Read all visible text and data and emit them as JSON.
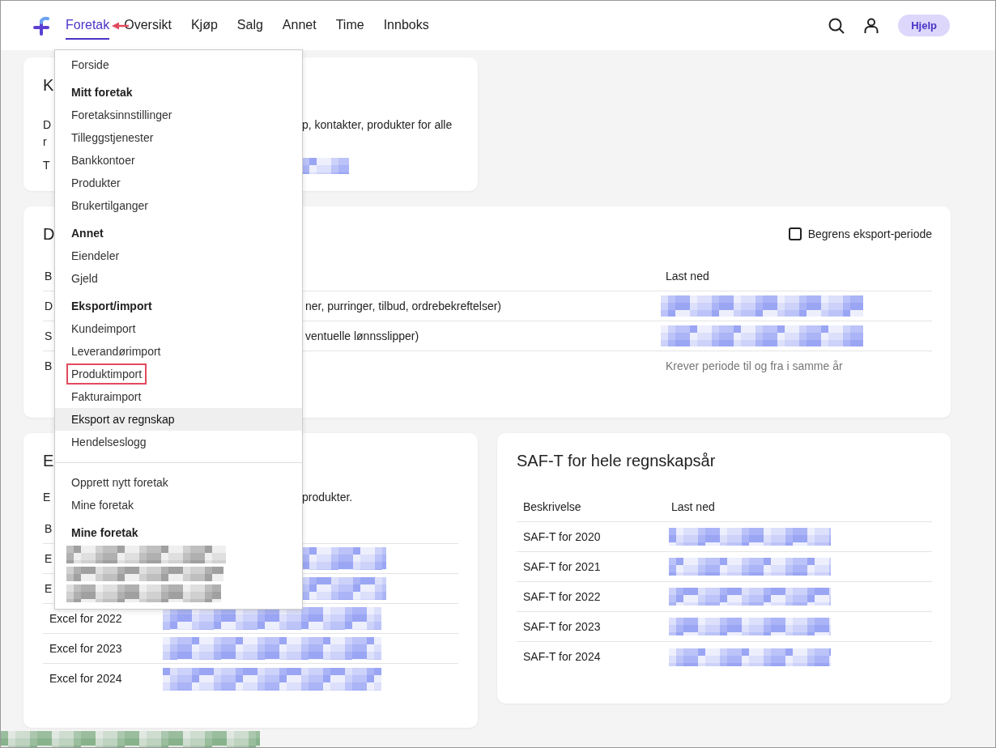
{
  "nav": {
    "items": [
      {
        "label": "Foretak",
        "selected": true,
        "pointed_at": true
      },
      {
        "label": "Oversikt",
        "selected": false,
        "pointed_at": false
      },
      {
        "label": "Kjøp",
        "selected": false,
        "pointed_at": false
      },
      {
        "label": "Salg",
        "selected": false,
        "pointed_at": false
      },
      {
        "label": "Annet",
        "selected": false,
        "pointed_at": false
      },
      {
        "label": "Time",
        "selected": false,
        "pointed_at": false
      },
      {
        "label": "Innboks",
        "selected": false,
        "pointed_at": false
      }
    ],
    "help_button": "Hjelp"
  },
  "dropdown": [
    {
      "kind": "link",
      "label": "Forside",
      "hovered": false,
      "highlighted": false
    },
    {
      "kind": "header",
      "label": "Mitt foretak"
    },
    {
      "kind": "link",
      "label": "Foretaksinnstillinger",
      "hovered": false,
      "highlighted": false
    },
    {
      "kind": "link",
      "label": "Tilleggstjenester",
      "hovered": false,
      "highlighted": false
    },
    {
      "kind": "link",
      "label": "Bankkontoer",
      "hovered": false,
      "highlighted": false
    },
    {
      "kind": "link",
      "label": "Produkter",
      "hovered": false,
      "highlighted": false
    },
    {
      "kind": "link",
      "label": "Brukertilganger",
      "hovered": false,
      "highlighted": false
    },
    {
      "kind": "header",
      "label": "Annet"
    },
    {
      "kind": "link",
      "label": "Eiendeler",
      "hovered": false,
      "highlighted": false
    },
    {
      "kind": "link",
      "label": "Gjeld",
      "hovered": false,
      "highlighted": false
    },
    {
      "kind": "header",
      "label": "Eksport/import"
    },
    {
      "kind": "link",
      "label": "Kundeimport",
      "hovered": false,
      "highlighted": false
    },
    {
      "kind": "link",
      "label": "Leverandørimport",
      "hovered": false,
      "highlighted": false
    },
    {
      "kind": "link",
      "label": "Produktimport",
      "hovered": false,
      "highlighted": true
    },
    {
      "kind": "link",
      "label": "Fakturaimport",
      "hovered": false,
      "highlighted": false
    },
    {
      "kind": "link",
      "label": "Eksport av regnskap",
      "hovered": true,
      "highlighted": false
    },
    {
      "kind": "link",
      "label": "Hendelseslogg",
      "hovered": false,
      "highlighted": false
    },
    {
      "kind": "divider"
    },
    {
      "kind": "link",
      "label": "Opprett nytt foretak",
      "hovered": false,
      "highlighted": false
    },
    {
      "kind": "link",
      "label": "Mine foretak",
      "hovered": false,
      "highlighted": false
    },
    {
      "kind": "header",
      "label": "Mine foretak"
    },
    {
      "kind": "redacted"
    },
    {
      "kind": "redacted"
    },
    {
      "kind": "redacted"
    }
  ],
  "company_card": {
    "title": "K",
    "lines": [
      {
        "left": "D",
        "right": "p, kontakter, produkter for alle"
      },
      {
        "left": "r"
      },
      {
        "left": "T",
        "redacted_link": true
      }
    ]
  },
  "data_card": {
    "title": "D",
    "limit_period": {
      "label": "Begrens eksport-periode",
      "checked": false
    },
    "columns": [
      {
        "left": "B"
      },
      {
        "left": "Last ned"
      }
    ],
    "rows": [
      {
        "left": "D",
        "right": "ner, purringer, tilbud, ordrebekreftelser)",
        "download": {
          "kind": "redacted"
        }
      },
      {
        "left": "S",
        "right": "ventuelle lønnsslipper)",
        "download": {
          "kind": "redacted"
        }
      },
      {
        "left": "B",
        "download": {
          "kind": "note",
          "text": "Krever periode til og fra i samme år"
        }
      }
    ]
  },
  "excel_card": {
    "title": "E",
    "intro": {
      "left": "E",
      "right": "produkter."
    },
    "columns": [
      {
        "left": "B"
      }
    ],
    "rows": [
      {
        "left": "E",
        "download": {
          "kind": "redacted",
          "covered": true
        }
      },
      {
        "left": "E",
        "download": {
          "kind": "redacted",
          "covered": true
        }
      },
      {
        "left": "Excel for 2022",
        "download": {
          "kind": "redacted",
          "covered": false
        }
      },
      {
        "left": "Excel for 2023",
        "download": {
          "kind": "redacted",
          "covered": false
        }
      },
      {
        "left": "Excel for 2024",
        "download": {
          "kind": "redacted",
          "covered": false
        }
      }
    ]
  },
  "saft_card": {
    "title": "SAF-T for hele regnskapsår",
    "columns": [
      "Beskrivelse",
      "Last ned"
    ],
    "rows": [
      {
        "label": "SAF-T for 2020",
        "download": {
          "kind": "redacted"
        }
      },
      {
        "label": "SAF-T for 2021",
        "download": {
          "kind": "redacted"
        }
      },
      {
        "label": "SAF-T for 2022",
        "download": {
          "kind": "redacted"
        }
      },
      {
        "label": "SAF-T for 2023",
        "download": {
          "kind": "redacted"
        }
      },
      {
        "label": "SAF-T for 2024",
        "download": {
          "kind": "redacted"
        }
      }
    ]
  },
  "bottom_strip": {
    "redacted": true
  }
}
